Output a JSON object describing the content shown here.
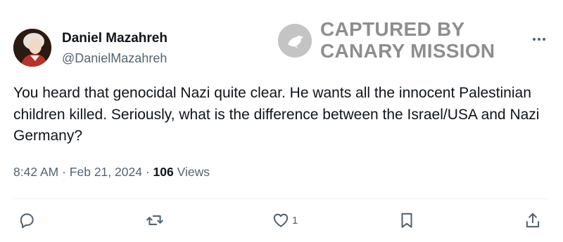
{
  "tweet": {
    "author": {
      "name": "Daniel Mazahreh",
      "handle": "@DanielMazahreh"
    },
    "text": "You heard that genocidal Nazi quite clear. He wants all the innocent Palestinian children killed. Seriously, what is the difference between the Israel/USA and Nazi Germany?",
    "time": "8:42 AM",
    "separator": "·",
    "date": "Feb 21, 2024",
    "views_count": "106",
    "views_label": "Views",
    "more_label": "···",
    "actions": {
      "reply": {
        "icon": "reply-icon"
      },
      "retweet": {
        "icon": "retweet-icon"
      },
      "like": {
        "icon": "heart-icon",
        "count": "1"
      },
      "bookmark": {
        "icon": "bookmark-icon"
      },
      "share": {
        "icon": "share-icon"
      }
    }
  },
  "watermark": {
    "line1": "CAPTURED BY",
    "line2": "CANARY MISSION",
    "icon": "canary-bird-icon"
  },
  "colors": {
    "text_primary": "#0f1419",
    "text_secondary": "#536471",
    "watermark": "#8e8e8e",
    "divider": "#eff3f4"
  }
}
